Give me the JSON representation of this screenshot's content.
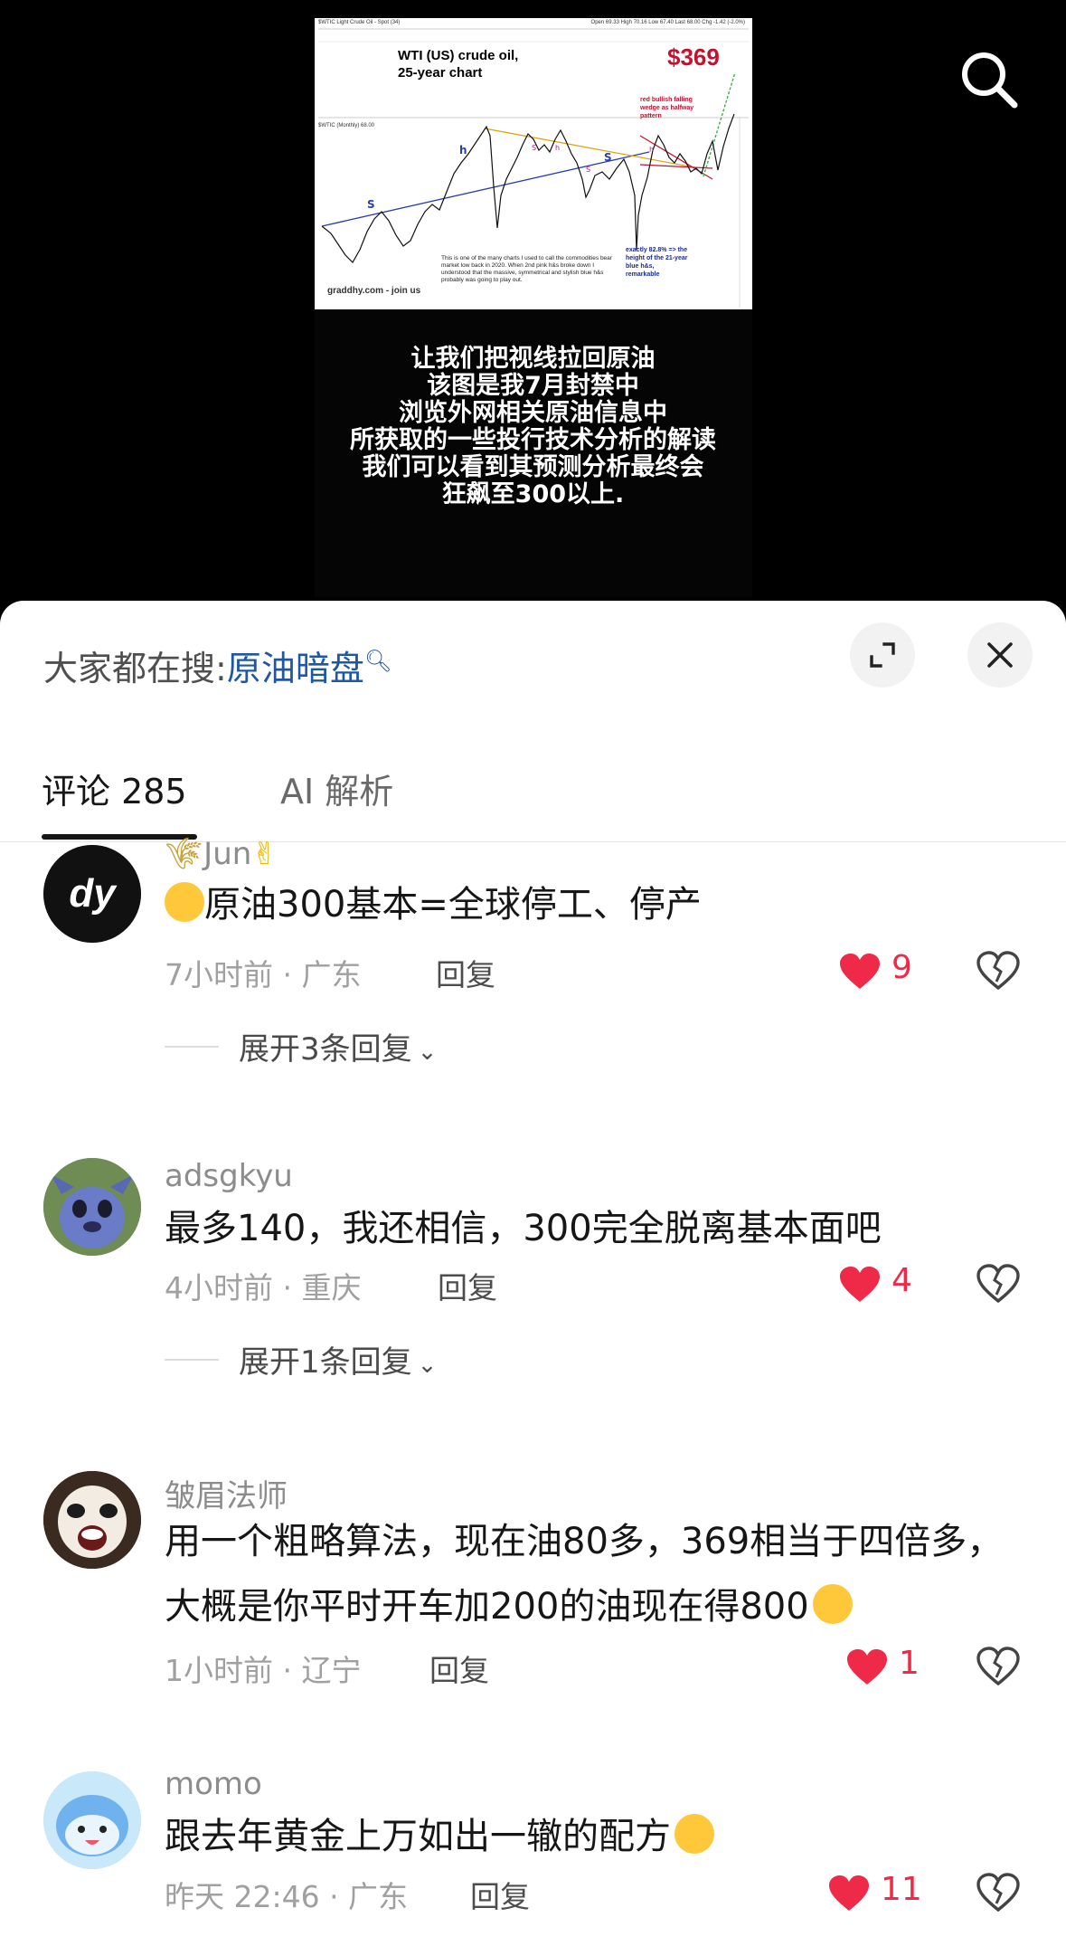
{
  "video": {
    "chart": {
      "top_left_tiny": "$WTIC Light Crude Oil - Spot (34)",
      "top_right_tiny": "Open 69.33  High 70.16  Low 67.40  Last 68.00  Chg -1.42 (-2.0%)",
      "sub_tiny": "$WTIC (Monthly) 68.00",
      "title_line1": "WTI (US) crude oil,",
      "title_line2": "25-year chart",
      "price": "$369",
      "note_red": "red bullish falling wedge as halfway pattern",
      "note_blue": "exactly 82.8% => the height of the 21-year blue h&s, remarkable",
      "note_body": "This is one of the many charts I used to call the commodities bear market low back in 2020. When 2nd pink h&s broke down I understood that the massive, symmetrical and stylish blue h&s probably was going to play out.",
      "footer": "graddhy.com - join us"
    },
    "caption_lines": [
      "让我们把视线拉回原油",
      "该图是我7月封禁中",
      "浏览外网相关原油信息中",
      "所获取的一些投行技术分析的解读",
      "我们可以看到其预测分析最终会",
      "狂飙至300以上."
    ]
  },
  "sheet": {
    "hot_search_prefix": "大家都在搜:",
    "hot_search_link": "原油暗盘",
    "tabs": [
      {
        "label": "评论 285"
      },
      {
        "label": "AI 解析"
      }
    ]
  },
  "comments": [
    {
      "username": "Jun",
      "content": "原油300基本=全球停工、停产",
      "time_location": "7小时前 · 广东",
      "reply_label": "回复",
      "likes": "9",
      "expand_label": "展开3条回复"
    },
    {
      "username": "adsgkyu",
      "content": "最多140，我还相信，300完全脱离基本面吧",
      "time_location": "4小时前 · 重庆",
      "reply_label": "回复",
      "likes": "4",
      "expand_label": "展开1条回复"
    },
    {
      "username": "皱眉法师",
      "content": "用一个粗略算法，现在油80多，369相当于四倍多，大概是你平时开车加200的油现在得800",
      "time_location": "1小时前 · 辽宁",
      "reply_label": "回复",
      "likes": "1"
    },
    {
      "username": "momo",
      "content": "跟去年黄金上万如出一辙的配方",
      "time_location": "昨天 22:46 · 广东",
      "reply_label": "回复",
      "likes": "11"
    }
  ],
  "colors": {
    "like_red": "#ef2a48",
    "link_blue": "#1f57a3",
    "price_red": "#c8102e"
  }
}
